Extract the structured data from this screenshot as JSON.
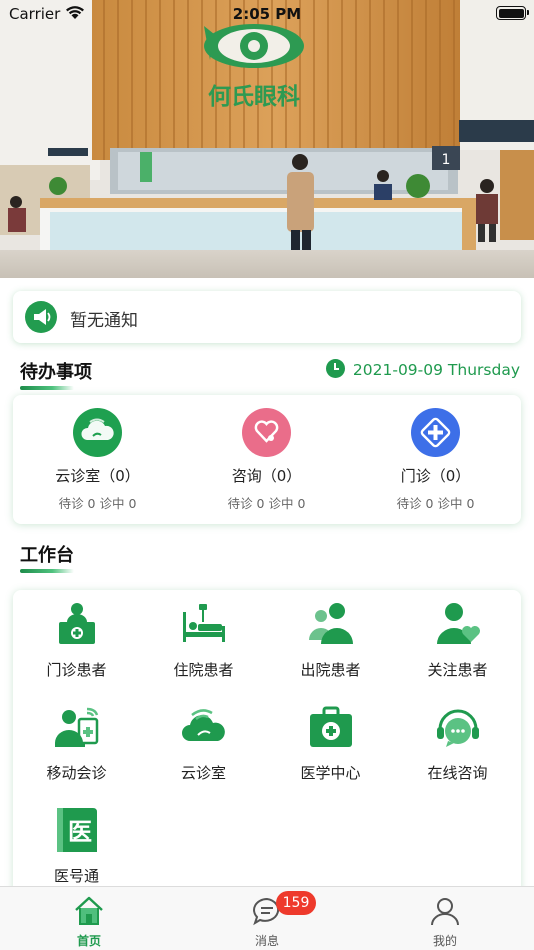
{
  "status_bar": {
    "carrier": "Carrier",
    "time": "2:05 PM"
  },
  "hero": {
    "sign_text": "何氏眼科"
  },
  "notice": {
    "text": "暂无通知",
    "icon": "megaphone-icon"
  },
  "todo": {
    "title": "待办事项",
    "date": "2021-09-09 Thursday",
    "items": [
      {
        "label": "云诊室（0）",
        "sub": "待诊 0 诊中 0",
        "icon": "cloud-clinic-icon",
        "color": "#1fa050"
      },
      {
        "label": "咨询（0）",
        "sub": "待诊 0 诊中 0",
        "icon": "stethoscope-heart-icon",
        "color": "#ea6d8a"
      },
      {
        "label": "门诊（0）",
        "sub": "待诊 0 诊中 0",
        "icon": "medical-cross-icon",
        "color": "#3d6fe8"
      }
    ]
  },
  "workbench": {
    "title": "工作台",
    "items": [
      {
        "label": "门诊患者",
        "icon": "doctor-desk-icon"
      },
      {
        "label": "住院患者",
        "icon": "hospital-bed-icon"
      },
      {
        "label": "出院患者",
        "icon": "people-icon"
      },
      {
        "label": "关注患者",
        "icon": "person-heart-icon"
      },
      {
        "label": "移动会诊",
        "icon": "mobile-consult-icon"
      },
      {
        "label": "云诊室",
        "icon": "cloud-icon"
      },
      {
        "label": "医学中心",
        "icon": "medical-kit-icon"
      },
      {
        "label": "在线咨询",
        "icon": "chat-headset-icon"
      },
      {
        "label": "医号通",
        "icon": "yi-book-icon"
      }
    ]
  },
  "tabbar": {
    "items": [
      {
        "label": "首页",
        "icon": "home-icon",
        "active": true
      },
      {
        "label": "消息",
        "icon": "message-icon",
        "badge": "159"
      },
      {
        "label": "我的",
        "icon": "user-icon"
      }
    ]
  },
  "colors": {
    "brand_green": "#1f9a4e",
    "badge_red": "#ee3a2c"
  }
}
